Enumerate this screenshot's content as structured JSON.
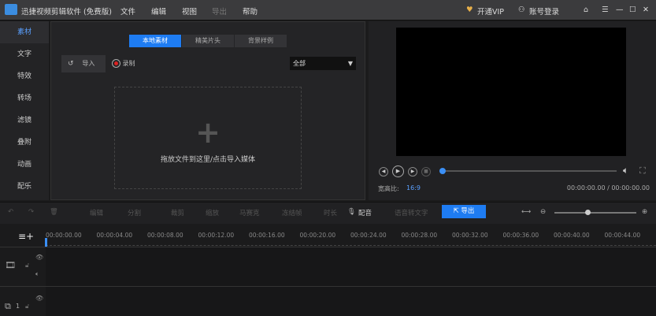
{
  "app": {
    "title": "迅捷视频剪辑软件 (免费版)",
    "menu": [
      "文件",
      "编辑",
      "视图",
      "导出",
      "帮助"
    ],
    "vip": "开通VIP",
    "login": "账号登录"
  },
  "sidebar": {
    "items": [
      "素材",
      "文字",
      "特效",
      "转场",
      "滤镜",
      "叠附",
      "动画",
      "配乐"
    ]
  },
  "media": {
    "tabs": [
      "本地素材",
      "精美片头",
      "背景样例"
    ],
    "import": "导入",
    "record": "录制",
    "filter": "全部",
    "drop_hint": "拖放文件到这里/点击导入媒体"
  },
  "preview": {
    "aspect_label": "宽高比:",
    "aspect_value": "16:9",
    "time": "00:00:00.00 / 00:00:00.00",
    "progress": 0
  },
  "toolbar": {
    "items": [
      "编辑",
      "分割",
      "裁剪",
      "缩放",
      "马赛克",
      "冻结帧",
      "时长",
      "配音",
      "语音转文字"
    ],
    "export": "导出",
    "zoom_level": 0.4
  },
  "timeline": {
    "ticks": [
      "00:00:00.00",
      "00:00:04.00",
      "00:00:08.00",
      "00:00:12.00",
      "00:00:16.00",
      "00:00:20.00",
      "00:00:24.00",
      "00:00:28.00",
      "00:00:32.00",
      "00:00:36.00",
      "00:00:40.00",
      "00:00:44.00"
    ],
    "track2_index": "1"
  },
  "colors": {
    "accent": "#1e7cf2",
    "titlebar": "#3b3b3d",
    "vip": "#e8b04a"
  }
}
